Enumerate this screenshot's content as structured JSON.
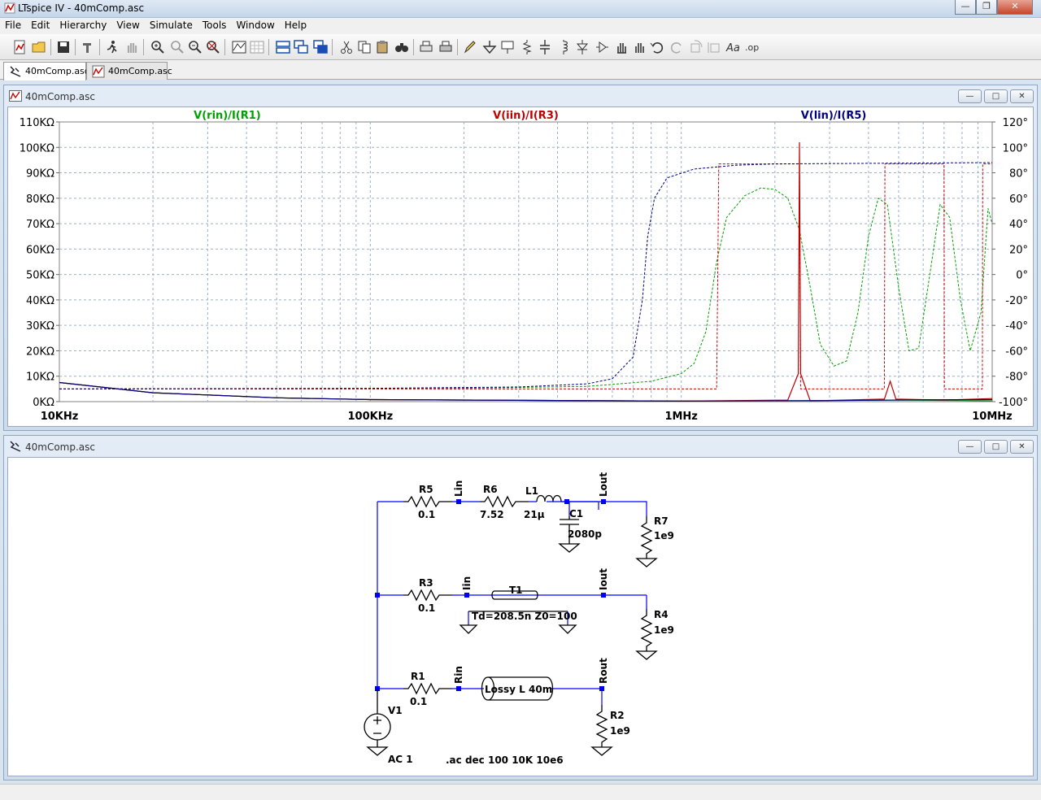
{
  "window": {
    "title": "LTspice IV - 40mComp.asc"
  },
  "menu": [
    "File",
    "Edit",
    "Hierarchy",
    "View",
    "Simulate",
    "Tools",
    "Window",
    "Help"
  ],
  "tabs": [
    {
      "label": "40mComp.asc",
      "kind": "schematic",
      "active": true
    },
    {
      "label": "40mComp.asc",
      "kind": "waveform",
      "active": false
    }
  ],
  "plot_window": {
    "title": "40mComp.asc"
  },
  "schematic_window": {
    "title": "40mComp.asc"
  },
  "chart_data": {
    "type": "line",
    "x_scale": "log",
    "xlim": [
      10000,
      10000000
    ],
    "x_ticks": [
      "10KHz",
      "100KHz",
      "1MHz",
      "10MHz"
    ],
    "ylim_left": [
      0,
      110000
    ],
    "y_ticks_left": [
      "110KΩ",
      "100KΩ",
      "90KΩ",
      "80KΩ",
      "70KΩ",
      "60KΩ",
      "50KΩ",
      "40KΩ",
      "30KΩ",
      "20KΩ",
      "10KΩ",
      "0KΩ"
    ],
    "ylim_right": [
      -100,
      120
    ],
    "y_ticks_right": [
      "120°",
      "100°",
      "80°",
      "60°",
      "40°",
      "20°",
      "0°",
      "-20°",
      "-40°",
      "-60°",
      "-80°",
      "-100°"
    ],
    "grid": true,
    "series": [
      {
        "name": "V(rin)/I(R1)",
        "color": "#00a000",
        "magnitude": [
          [
            10000,
            7500
          ],
          [
            20000,
            3500
          ],
          [
            50000,
            1500
          ],
          [
            100000,
            800
          ],
          [
            1000000,
            200
          ],
          [
            3000000,
            400
          ],
          [
            5000000,
            600
          ],
          [
            8000000,
            400
          ],
          [
            10000000,
            300
          ]
        ],
        "phase": [
          [
            10000,
            -90
          ],
          [
            100000,
            -90
          ],
          [
            200000,
            -89.5
          ],
          [
            500000,
            -88
          ],
          [
            800000,
            -84
          ],
          [
            1000000,
            -78
          ],
          [
            1100000,
            -70
          ],
          [
            1200000,
            -45
          ],
          [
            1300000,
            10
          ],
          [
            1400000,
            45
          ],
          [
            1600000,
            62
          ],
          [
            1800000,
            68
          ],
          [
            2000000,
            67
          ],
          [
            2200000,
            60
          ],
          [
            2400000,
            35
          ],
          [
            2600000,
            -10
          ],
          [
            2800000,
            -55
          ],
          [
            3100000,
            -72
          ],
          [
            3400000,
            -68
          ],
          [
            3700000,
            -30
          ],
          [
            4000000,
            30
          ],
          [
            4300000,
            60
          ],
          [
            4600000,
            55
          ],
          [
            5000000,
            -10
          ],
          [
            5400000,
            -60
          ],
          [
            5800000,
            -58
          ],
          [
            6300000,
            0
          ],
          [
            6800000,
            55
          ],
          [
            7300000,
            45
          ],
          [
            7900000,
            -20
          ],
          [
            8500000,
            -60
          ],
          [
            9200000,
            -30
          ],
          [
            9700000,
            52
          ],
          [
            10000000,
            40
          ]
        ]
      },
      {
        "name": "V(iin)/I(R3)",
        "color": "#c00000",
        "magnitude": [
          [
            10000,
            7500
          ],
          [
            20000,
            3500
          ],
          [
            50000,
            1500
          ],
          [
            100000,
            800
          ],
          [
            1000000,
            200
          ],
          [
            2200000,
            600
          ],
          [
            2380000,
            11000
          ],
          [
            2400000,
            102000
          ],
          [
            2420000,
            11000
          ],
          [
            2600000,
            300
          ],
          [
            4500000,
            1000
          ],
          [
            4700000,
            8000
          ],
          [
            4900000,
            1000
          ],
          [
            7000000,
            600
          ],
          [
            10000000,
            1200
          ]
        ],
        "phase": [
          [
            10000,
            -90
          ],
          [
            1300000,
            -90
          ],
          [
            1320000,
            87
          ],
          [
            2400000,
            87
          ],
          [
            2420000,
            -90
          ],
          [
            4500000,
            -90
          ],
          [
            4520000,
            87
          ],
          [
            7000000,
            87
          ],
          [
            7020000,
            -90
          ],
          [
            9300000,
            -90
          ],
          [
            9320000,
            87
          ],
          [
            10000000,
            87
          ]
        ]
      },
      {
        "name": "V(lin)/I(R5)",
        "color": "#00007f",
        "magnitude": [
          [
            10000,
            7500
          ],
          [
            20000,
            3500
          ],
          [
            50000,
            1500
          ],
          [
            100000,
            800
          ],
          [
            1000000,
            200
          ],
          [
            3000000,
            400
          ],
          [
            6000000,
            700
          ],
          [
            10000000,
            800
          ]
        ],
        "phase": [
          [
            10000,
            -90
          ],
          [
            100000,
            -89.5
          ],
          [
            300000,
            -88.5
          ],
          [
            500000,
            -86
          ],
          [
            600000,
            -82
          ],
          [
            700000,
            -65
          ],
          [
            750000,
            -20
          ],
          [
            780000,
            30
          ],
          [
            820000,
            60
          ],
          [
            900000,
            76
          ],
          [
            1100000,
            83
          ],
          [
            1500000,
            86
          ],
          [
            2000000,
            87
          ],
          [
            10000000,
            88
          ]
        ]
      }
    ]
  },
  "schematic": {
    "components": [
      {
        "ref": "R5",
        "value": "0.1"
      },
      {
        "ref": "R6",
        "value": "7.52"
      },
      {
        "ref": "L1",
        "value": "21µ"
      },
      {
        "ref": "C1",
        "value": "2080p"
      },
      {
        "ref": "R7",
        "value": "1e9"
      },
      {
        "ref": "R3",
        "value": "0.1"
      },
      {
        "ref": "T1",
        "value": "Td=208.5n Z0=100"
      },
      {
        "ref": "R4",
        "value": "1e9"
      },
      {
        "ref": "R1",
        "value": "0.1"
      },
      {
        "ref": "Lossy",
        "value": "Lossy L 40m"
      },
      {
        "ref": "R2",
        "value": "1e9"
      },
      {
        "ref": "V1",
        "value": "AC 1"
      }
    ],
    "net_labels": [
      "Lin",
      "Lout",
      "Iin",
      "Iout",
      "Rin",
      "Rout"
    ],
    "directive": ".ac dec 100 10K 10e6"
  }
}
